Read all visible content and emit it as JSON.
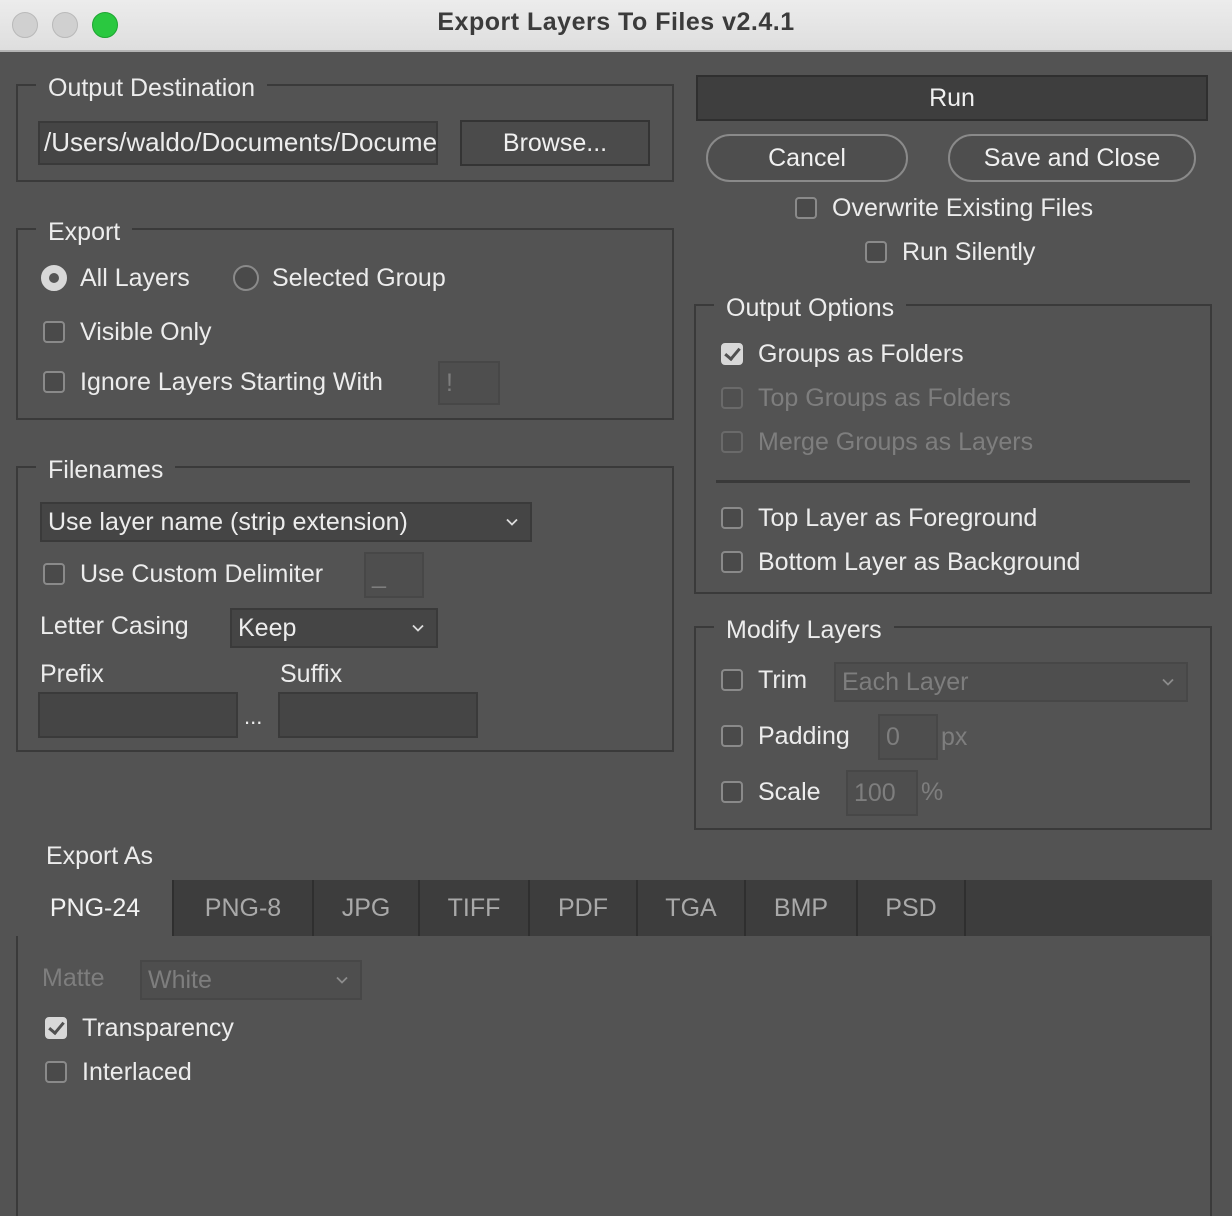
{
  "window": {
    "title": "Export Layers To Files v2.4.1"
  },
  "output_destination": {
    "legend": "Output Destination",
    "path": "/Users/waldo/Documents/Documents",
    "browse_label": "Browse..."
  },
  "actions": {
    "run_label": "Run",
    "cancel_label": "Cancel",
    "save_close_label": "Save and Close",
    "overwrite": {
      "label": "Overwrite Existing Files",
      "checked": false
    },
    "run_silently": {
      "label": "Run Silently",
      "checked": false
    }
  },
  "export": {
    "legend": "Export",
    "radio_all": {
      "label": "All Layers",
      "selected": true
    },
    "radio_selected_group": {
      "label": "Selected Group",
      "selected": false
    },
    "visible_only": {
      "label": "Visible Only",
      "checked": false
    },
    "ignore_layers": {
      "label": "Ignore Layers Starting With",
      "checked": false,
      "value": "!"
    }
  },
  "filenames": {
    "legend": "Filenames",
    "naming_option": "Use layer name (strip extension)",
    "custom_delimiter": {
      "label": "Use Custom Delimiter",
      "checked": false,
      "value": "_"
    },
    "letter_casing_label": "Letter Casing",
    "letter_casing_value": "Keep",
    "prefix_label": "Prefix",
    "suffix_label": "Suffix",
    "ellipsis": "...",
    "prefix_value": "",
    "suffix_value": ""
  },
  "output_options": {
    "legend": "Output Options",
    "groups_as_folders": {
      "label": "Groups as Folders",
      "checked": true
    },
    "top_groups_as_folders": {
      "label": "Top Groups as Folders",
      "checked": false,
      "disabled": true
    },
    "merge_groups_as_layers": {
      "label": "Merge Groups as Layers",
      "checked": false,
      "disabled": true
    },
    "top_layer_foreground": {
      "label": "Top Layer as Foreground",
      "checked": false
    },
    "bottom_layer_background": {
      "label": "Bottom Layer as Background",
      "checked": false
    }
  },
  "modify_layers": {
    "legend": "Modify Layers",
    "trim": {
      "label": "Trim",
      "checked": false,
      "option": "Each Layer"
    },
    "padding": {
      "label": "Padding",
      "checked": false,
      "value": "0",
      "unit": "px"
    },
    "scale": {
      "label": "Scale",
      "checked": false,
      "value": "100",
      "unit": "%"
    }
  },
  "export_as": {
    "heading": "Export As",
    "tabs": [
      "PNG-24",
      "PNG-8",
      "JPG",
      "TIFF",
      "PDF",
      "TGA",
      "BMP",
      "PSD"
    ],
    "active_tab": "PNG-24",
    "matte_label": "Matte",
    "matte_value": "White",
    "transparency": {
      "label": "Transparency",
      "checked": true
    },
    "interlaced": {
      "label": "Interlaced",
      "checked": false
    }
  }
}
